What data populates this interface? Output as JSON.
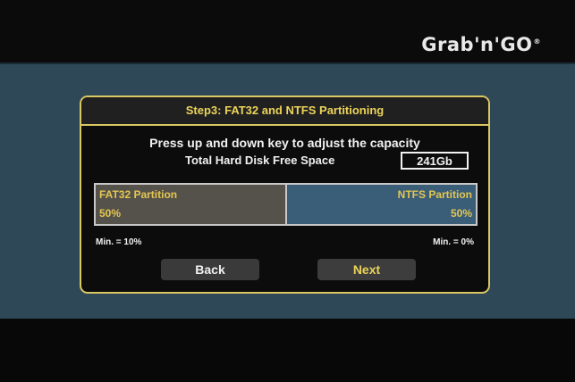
{
  "brand": {
    "logo_text": "Grab'n'GO",
    "logo_mark": "®"
  },
  "dialog": {
    "title": "Step3: FAT32 and NTFS Partitioning",
    "instruction": "Press up and down key to adjust the capacity",
    "free_space_label": "Total Hard Disk Free Space",
    "free_space_value": "241Gb"
  },
  "partitions": {
    "fat32": {
      "name": "FAT32 Partition",
      "percent_label": "50%",
      "min_label": "Min. = 10%"
    },
    "ntfs": {
      "name": "NTFS Partition",
      "percent_label": "50%",
      "min_label": "Min. = 0%"
    },
    "fat32_share": 0.5
  },
  "buttons": {
    "back": "Back",
    "next": "Next"
  },
  "colors": {
    "accent_yellow": "#ecd45a",
    "panel_blue": "#2f4857",
    "fat32_fill": "#55524b",
    "ntfs_fill": "#3a5d78"
  }
}
